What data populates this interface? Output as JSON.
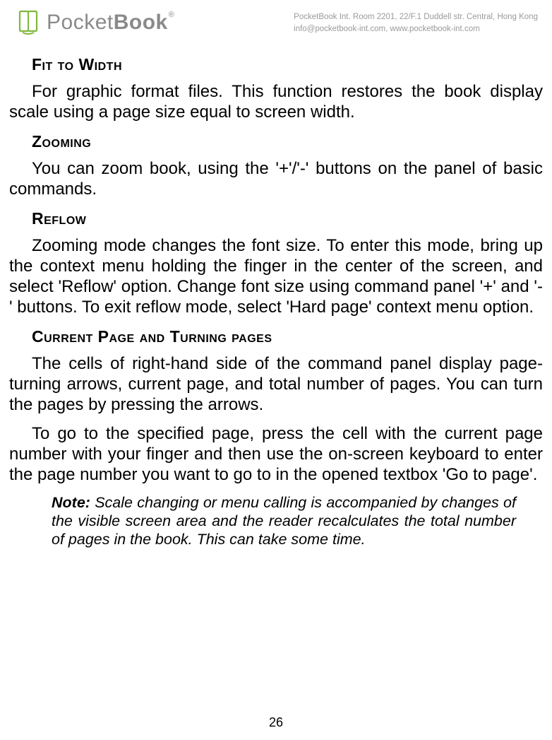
{
  "header": {
    "logo_text_1": "Pocket",
    "logo_text_2": "Book",
    "company_line1": "PocketBook Int. Room 2201, 22/F.1 Duddell str. Central, Hong Kong",
    "company_line2": "info@pocketbook-int.com, www.pocketbook-int.com"
  },
  "sections": {
    "fit_to_width": {
      "heading": "Fit to Width",
      "text": "For graphic format files. This function restores the book display scale using a page size equal to screen width."
    },
    "zooming": {
      "heading": "Zooming",
      "text": "You can zoom book, using the '+'/'-' buttons on the panel of basic commands."
    },
    "reflow": {
      "heading": "Reflow",
      "text": "Zooming mode changes the font size. To enter this mode, bring up the context menu holding the finger in the center of the screen, and select 'Reflow' option. Change font size using command panel '+' and '-' buttons. To exit reflow mode, select 'Hard page' context menu option."
    },
    "current_page": {
      "heading": "Current Page and Turning pages",
      "text1": "The cells of right-hand side of the command panel display page-turning arrows, current page, and total number of pages. You can turn the pages by pressing the arrows.",
      "text2": "To go to the specified page, press the cell with the current page number with your finger and then use the on-screen keyboard to enter the page number you want to go to in the opened textbox 'Go to page'."
    }
  },
  "note": {
    "label": "Note:",
    "text": " Scale changing or menu calling is accompanied by changes of the visible screen area and the reader recalculates the total number of pages in the book. This can take some time."
  },
  "page_number": "26"
}
